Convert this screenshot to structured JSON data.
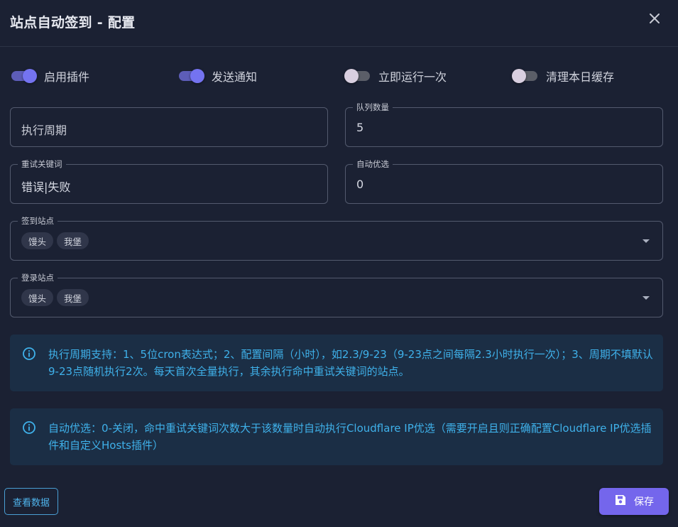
{
  "dialog": {
    "title": "站点自动签到 - 配置",
    "close_icon": "close-icon"
  },
  "switches": [
    {
      "label": "启用插件",
      "on": true
    },
    {
      "label": "发送通知",
      "on": true
    },
    {
      "label": "立即运行一次",
      "on": false
    },
    {
      "label": "清理本日缓存",
      "on": false
    }
  ],
  "fields": {
    "cron": {
      "placeholder": "执行周期",
      "value": ""
    },
    "queue_count": {
      "label": "队列数量",
      "value": "5"
    },
    "retry_keywords": {
      "label": "重试关键词",
      "value": "错误|失败"
    },
    "auto_select": {
      "label": "自动优选",
      "value": "0"
    },
    "sign_sites": {
      "label": "签到站点",
      "chips": [
        "馒头",
        "我堡"
      ]
    },
    "login_sites": {
      "label": "登录站点",
      "chips": [
        "馒头",
        "我堡"
      ]
    }
  },
  "alerts": [
    {
      "icon": "info-icon",
      "text": "执行周期支持：1、5位cron表达式；2、配置间隔（小时），如2.3/9-23（9-23点之间每隔2.3小时执行一次）；3、周期不填默认9-23点随机执行2次。每天首次全量执行，其余执行命中重试关键词的站点。"
    },
    {
      "icon": "info-icon",
      "text": "自动优选：0-关闭，命中重试关键词次数大于该数量时自动执行Cloudflare IP优选（需要开启且则正确配置Cloudflare IP优选插件和自定义Hosts插件）"
    }
  ],
  "footer": {
    "view_data_label": "查看数据",
    "save_label": "保存",
    "save_icon": "save-icon"
  },
  "colors": {
    "background": "#1b2133",
    "accent": "#7466ec",
    "info": "#3fb1ea"
  }
}
